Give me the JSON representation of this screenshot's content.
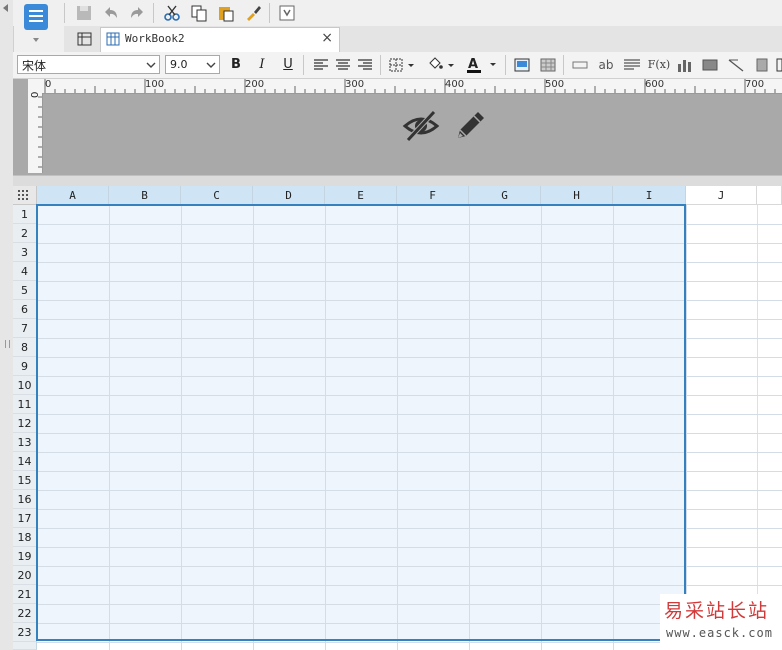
{
  "tab": {
    "label": "WorkBook2",
    "close": "×"
  },
  "format": {
    "font": "宋体",
    "size": "9.0",
    "bold": "B",
    "italic": "I",
    "underline": "U",
    "text_ab": "ab",
    "formula": "F(x)"
  },
  "ruler": {
    "h_labels": [
      "0",
      "100",
      "200",
      "300",
      "400",
      "500",
      "600",
      "700"
    ],
    "v_label": "0"
  },
  "columns": [
    "A",
    "B",
    "C",
    "D",
    "E",
    "F",
    "G",
    "H",
    "I",
    "J"
  ],
  "rows": [
    "1",
    "2",
    "3",
    "4",
    "5",
    "6",
    "7",
    "8",
    "9",
    "10",
    "11",
    "12",
    "13",
    "14",
    "15",
    "16",
    "17",
    "18",
    "19",
    "20",
    "21",
    "22",
    "23"
  ],
  "watermark": {
    "cn": "易采站长站",
    "en": "www.easck.com"
  },
  "colors": {
    "selection_border": "#3580bf",
    "selection_fill": "#eef5fc",
    "header_highlight": "#cfe5f5",
    "accent": "#3b8ad9"
  }
}
